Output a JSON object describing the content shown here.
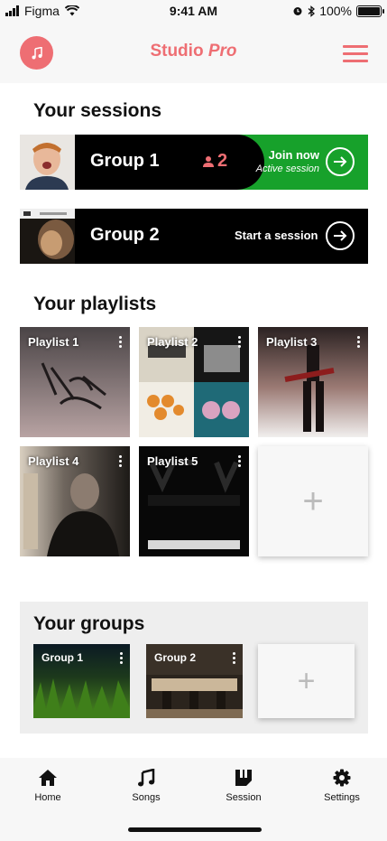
{
  "status_bar": {
    "carrier": "Figma",
    "time": "9:41 AM",
    "battery": "100%"
  },
  "header": {
    "brand_main": "Studio",
    "brand_italic": "Pro"
  },
  "sessions": {
    "title": "Your sessions",
    "items": [
      {
        "name": "Group 1",
        "members": "2",
        "action": "Join now",
        "status": "Active session"
      },
      {
        "name": "Group 2",
        "action": "Start a session"
      }
    ]
  },
  "playlists": {
    "title": "Your playlists",
    "items": [
      {
        "label": "Playlist 1"
      },
      {
        "label": "Playlist 2"
      },
      {
        "label": "Playlist 3"
      },
      {
        "label": "Playlist 4"
      },
      {
        "label": "Playlist 5"
      }
    ],
    "add_symbol": "+"
  },
  "groups": {
    "title": "Your groups",
    "items": [
      {
        "label": "Group 1"
      },
      {
        "label": "Group 2"
      }
    ],
    "add_symbol": "+"
  },
  "nav": [
    {
      "label": "Home",
      "icon": "home-icon"
    },
    {
      "label": "Songs",
      "icon": "music-note-icon"
    },
    {
      "label": "Session",
      "icon": "session-icon"
    },
    {
      "label": "Settings",
      "icon": "gear-icon"
    }
  ],
  "colors": {
    "accent": "#ee6e73",
    "active_green": "#17a12b",
    "background": "#ffffff",
    "bar": "#f7f7f7"
  }
}
